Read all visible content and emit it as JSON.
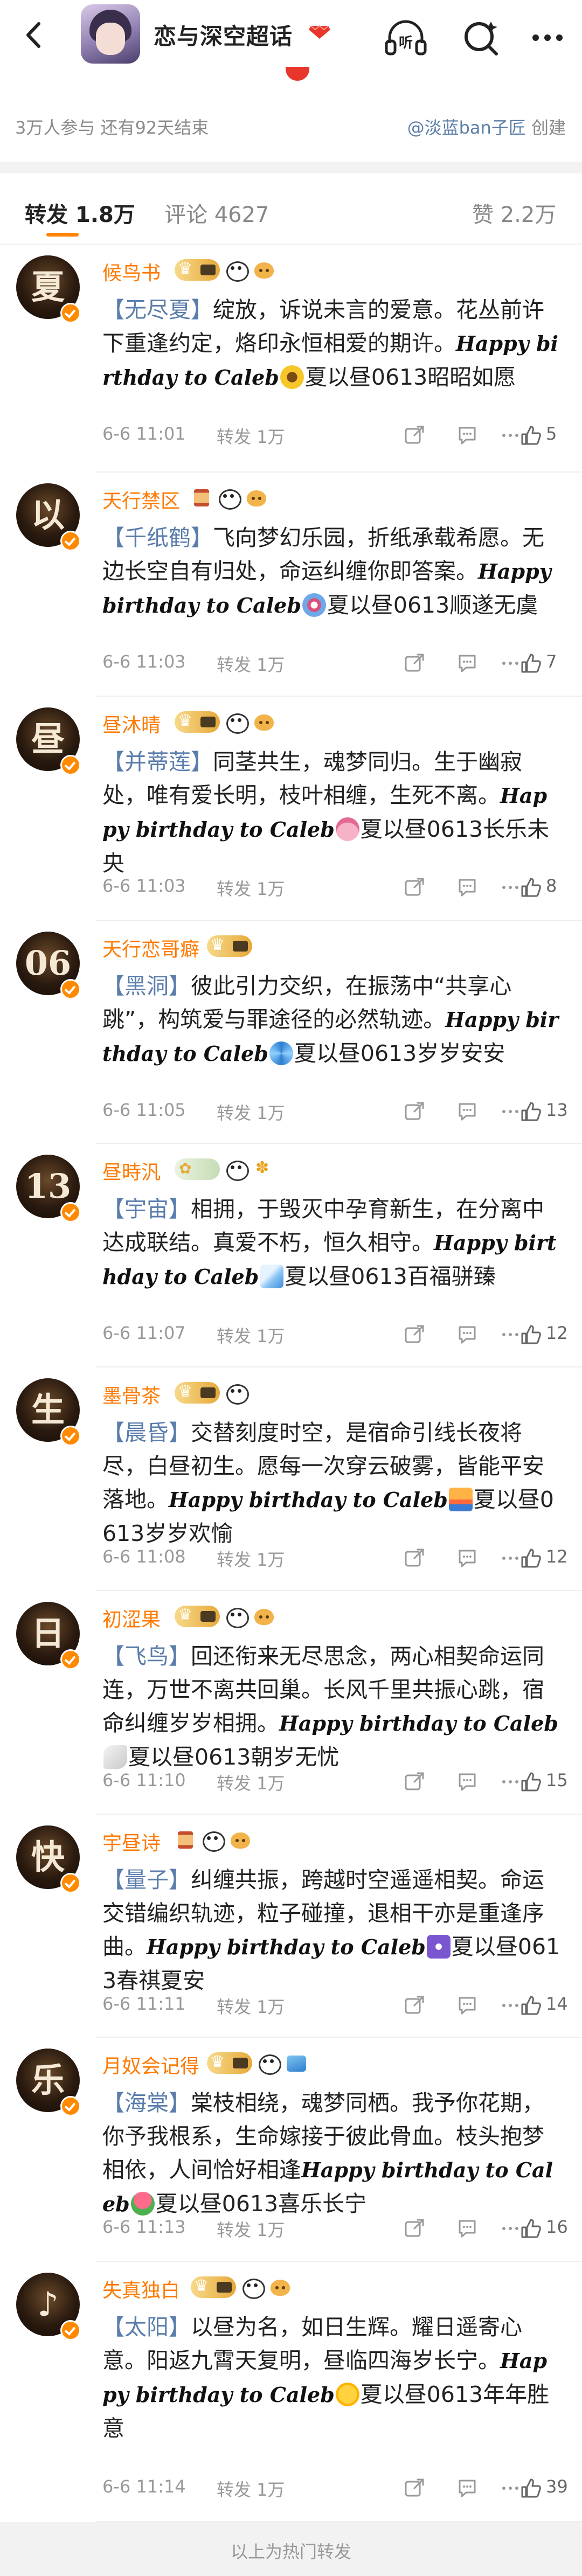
{
  "header": {
    "title": "恋与深空超话",
    "listen_label": "听"
  },
  "info": {
    "stats": "3万人参与  还有92天结束",
    "creator_link": "@淡蓝ban子匠",
    "creator_suffix": " 创建"
  },
  "tabs": [
    {
      "label": "转发 1.8万",
      "active": true
    },
    {
      "label": "评论 4627",
      "active": false
    },
    {
      "label": "赞 2.2万",
      "active": false
    }
  ],
  "posts": [
    {
      "avatar_glyph": "夏",
      "name": "候鸟书",
      "badges": [
        "vip",
        "panda",
        "dog"
      ],
      "tag": "【无尽夏】",
      "text": "绽放，诉说未言的爱意。花丛前许下重逢约定，烙印永恒相爱的期许。",
      "script": "Happy birthday to Caleb",
      "emoji": "sunflower",
      "tail": "夏以昼0613昭昭如愿",
      "time": "6-6 11:01",
      "forwards": "转发 1万",
      "likes": "5"
    },
    {
      "avatar_glyph": "以",
      "name": "天行禁区",
      "badges": [
        "hourglass",
        "panda",
        "dog"
      ],
      "tag": "【千纸鹤】",
      "text": "飞向梦幻乐园，折纸承载希愿。无边长空自有归处，命运纠缠你即答案。",
      "script": "Happy birthday to Caleb",
      "emoji": "ferris-wheel",
      "tail": "夏以昼0613顺遂无虞",
      "time": "6-6 11:03",
      "forwards": "转发 1万",
      "likes": "7"
    },
    {
      "avatar_glyph": "昼",
      "name": "昼沐晴",
      "badges": [
        "vip",
        "panda",
        "dog"
      ],
      "tag": "【并蒂莲】",
      "text": "同茎共生，魂梦同归。生于幽寂处，唯有爱长明，枝叶相缠，生死不离。",
      "script": "Happy birthday to Caleb",
      "emoji": "lotus",
      "tail": "夏以昼0613长乐未央",
      "time": "6-6 11:03",
      "forwards": "转发 1万",
      "likes": "8"
    },
    {
      "avatar_glyph": "06",
      "name": "天行恋哥癖",
      "badges": [
        "vip"
      ],
      "tag": "【黑洞】",
      "text": "彼此引力交织，在振荡中“共享心跳”，构筑爱与罪途径的必然轨迹。",
      "script": "Happy birthday to Caleb",
      "emoji": "cyclone",
      "tail": "夏以昼0613岁岁安安",
      "time": "6-6 11:05",
      "forwards": "转发 1万",
      "likes": "13"
    },
    {
      "avatar_glyph": "13",
      "name": "昼時汎",
      "badges": [
        "vip-green",
        "panda",
        "flower"
      ],
      "tag": "【宇宙】",
      "text": "相拥，于毁灭中孕育新生，在分离中达成联结。真爱不朽，恒久相守。",
      "script": "Happy birthday to Caleb",
      "emoji": "comet",
      "tail": "夏以昼0613百福骈臻",
      "time": "6-6 11:07",
      "forwards": "转发 1万",
      "likes": "12"
    },
    {
      "avatar_glyph": "生",
      "name": "墨骨茶",
      "badges": [
        "vip",
        "panda"
      ],
      "tag": "【晨昏】",
      "text": "交替刻度时空，是宿命引线长夜将尽，白昼初生。愿每一次穿云破雾，皆能平安落地。",
      "script": "Happy birthday to Caleb",
      "emoji": "sunrise",
      "tail": "夏以昼0613岁岁欢愉",
      "time": "6-6 11:08",
      "forwards": "转发 1万",
      "likes": "12"
    },
    {
      "avatar_glyph": "日",
      "name": "初涩果",
      "badges": [
        "vip",
        "panda",
        "dog"
      ],
      "tag": "【飞鸟】",
      "text": "回还衔来无尽思念，两心相契命运同连，万世不离共回巢。长风千里共振心跳，宿命纠缠岁岁相拥。",
      "script": "Happy birthday to Caleb",
      "emoji": "wing",
      "tail": "夏以昼0613朝岁无忧",
      "time": "6-6 11:10",
      "forwards": "转发 1万",
      "likes": "15"
    },
    {
      "avatar_glyph": "快",
      "name": "宇昼诗",
      "badges": [
        "hourglass",
        "panda",
        "dog"
      ],
      "tag": "【量子】",
      "text": "纠缠共振，跨越时空遥遥相契。命运交错编织轨迹，粒子碰撞，退相干亦是重逢序曲。",
      "script": "Happy birthday to Caleb",
      "emoji": "atom",
      "tail": "夏以昼0613春祺夏安",
      "time": "6-6 11:11",
      "forwards": "转发 1万",
      "likes": "14"
    },
    {
      "avatar_glyph": "乐",
      "name": "月奴会记得",
      "badges": [
        "vip",
        "panda",
        "wave"
      ],
      "tag": "【海棠】",
      "text": "棠枝相绕，魂梦同栖。我予你花期，你予我根系，生命嫁接于彼此骨血。枝头抱梦相依，人间恰好相逢",
      "script": "Happy birthday to Caleb",
      "emoji": "tulip",
      "tail": "夏以昼0613喜乐长宁",
      "time": "6-6 11:13",
      "forwards": "转发 1万",
      "likes": "16"
    },
    {
      "avatar_glyph": "♪",
      "name": "失真独白",
      "badges": [
        "vip",
        "panda",
        "dog"
      ],
      "tag": "【太阳】",
      "text": "以昼为名，如日生辉。耀日遥寄心意。阳返九霄天复明，昼临四海岁长宁。",
      "script": "Happy birthday to Caleb",
      "emoji": "sun",
      "tail": "夏以昼0613年年胜意",
      "time": "6-6 11:14",
      "forwards": "转发 1万",
      "likes": "39"
    }
  ],
  "footer": {
    "text": "以上为热门转发"
  },
  "colors": {
    "accent": "#ff8200",
    "name": "#ff7a00",
    "tag": "#5a7dab",
    "meta": "#999999"
  }
}
